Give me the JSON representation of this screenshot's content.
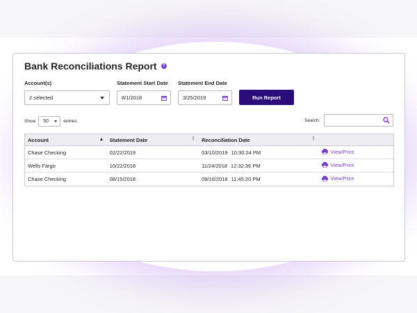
{
  "page": {
    "title": "Bank Reconciliations Report",
    "help_icon": "question-circle-icon",
    "accent_color": "#7a3fc9",
    "button_color": "#2c0c7a"
  },
  "filters": {
    "account_label": "Account(s)",
    "account_value": "2 selected",
    "start_label": "Statement Start Date",
    "start_value": "8/1/2018",
    "end_label": "Statement End Date",
    "end_value": "3/25/2019",
    "run_button": "Run Report"
  },
  "table_controls": {
    "show_label": "Show",
    "entries_value": "50",
    "entries_label": "entries",
    "search_label": "Search:",
    "search_value": ""
  },
  "table": {
    "headers": [
      "Account",
      "Statement Date",
      "Reconciliation Date",
      ""
    ],
    "rows": [
      {
        "account": "Chase Checking",
        "statement_date": "02/22/2019",
        "recon_date": "03/10/2019",
        "recon_time": "10:30:24 PM",
        "action": "View/Print"
      },
      {
        "account": "Wells Fargo",
        "statement_date": "10/22/2018",
        "recon_date": "11/24/2018",
        "recon_time": "12:32:36 PM",
        "action": "View/Print"
      },
      {
        "account": "Chase Checking",
        "statement_date": "08/15/2018",
        "recon_date": "09/16/2018",
        "recon_time": "11:45:20 PM",
        "action": "View/Print"
      }
    ]
  }
}
